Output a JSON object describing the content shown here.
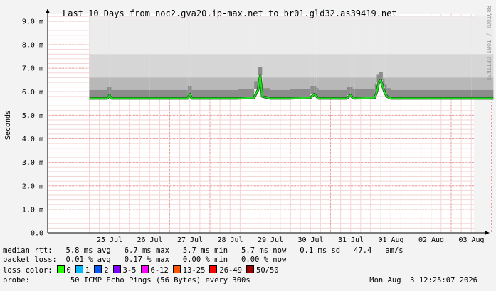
{
  "chart_data": {
    "type": "line",
    "title": "Last 10 Days from noc2.gva20.ip-max.net to br01.gld32.as39419.net",
    "ylabel": "Seconds",
    "ylim": [
      0,
      9.3
    ],
    "y_ticks": [
      "0.0",
      "1.0 m",
      "2.0 m",
      "3.0 m",
      "4.0 m",
      "5.0 m",
      "6.0 m",
      "7.0 m",
      "8.0 m",
      "9.0 m"
    ],
    "y_tick_values": [
      0,
      1,
      2,
      3,
      4,
      5,
      6,
      7,
      8,
      9
    ],
    "x_ticks": [
      "25 Jul",
      "26 Jul",
      "27 Jul",
      "28 Jul",
      "29 Jul",
      "30 Jul",
      "31 Jul",
      "01 Aug",
      "02 Aug",
      "03 Aug"
    ],
    "x_tick_days": [
      1,
      2,
      3,
      4,
      5,
      6,
      7,
      8,
      9,
      10
    ],
    "grid": true,
    "series": [
      {
        "name": "median rtt",
        "color": "#22dd22",
        "x_days": [
          0,
          0.45,
          0.5,
          0.55,
          1.5,
          2.45,
          2.5,
          2.55,
          3.7,
          4.1,
          4.2,
          4.25,
          4.3,
          4.5,
          5.0,
          5.5,
          5.6,
          5.65,
          5.7,
          6.0,
          6.4,
          6.5,
          6.55,
          6.6,
          7.1,
          7.15,
          7.2,
          7.25,
          7.3,
          7.35,
          7.4,
          7.5,
          8.0,
          8.5,
          9.0,
          9.5,
          10.0,
          10.05
        ],
        "y_ms": [
          5.72,
          5.72,
          5.85,
          5.72,
          5.72,
          5.72,
          5.9,
          5.72,
          5.72,
          5.75,
          6.1,
          6.7,
          5.8,
          5.72,
          5.72,
          5.75,
          5.9,
          5.8,
          5.72,
          5.72,
          5.72,
          5.85,
          5.75,
          5.72,
          5.75,
          6.0,
          6.4,
          6.5,
          6.2,
          5.95,
          5.8,
          5.72,
          5.72,
          5.72,
          5.72,
          5.72,
          5.72,
          5.72
        ]
      }
    ],
    "watermark": "RRDTOOL / TOBI OETIKER"
  },
  "stats": {
    "median_rtt_label": "median rtt:",
    "median_rtt_values": "5.8 ms avg   6.7 ms max   5.7 ms min   5.7 ms now   0.1 ms sd   47.4   am/s",
    "packet_loss_label": "packet loss:",
    "packet_loss_values": "0.01 % avg   0.17 % max   0.00 % min   0.00 % now",
    "loss_color_label": "loss color:",
    "loss_legend": [
      {
        "label": "0",
        "color": "#26ff00"
      },
      {
        "label": "1",
        "color": "#00b8ff"
      },
      {
        "label": "2",
        "color": "#0059ff"
      },
      {
        "label": "3-5",
        "color": "#7e00ff"
      },
      {
        "label": "6-12",
        "color": "#ff00ff"
      },
      {
        "label": "13-25",
        "color": "#ff5500"
      },
      {
        "label": "26-49",
        "color": "#ff0000"
      },
      {
        "label": "50/50",
        "color": "#a10000"
      }
    ],
    "probe_label": "probe:",
    "probe_values": "50 ICMP Echo Pings (56 Bytes) every 300s",
    "timestamp": "Mon Aug  3 12:25:07 2026"
  }
}
